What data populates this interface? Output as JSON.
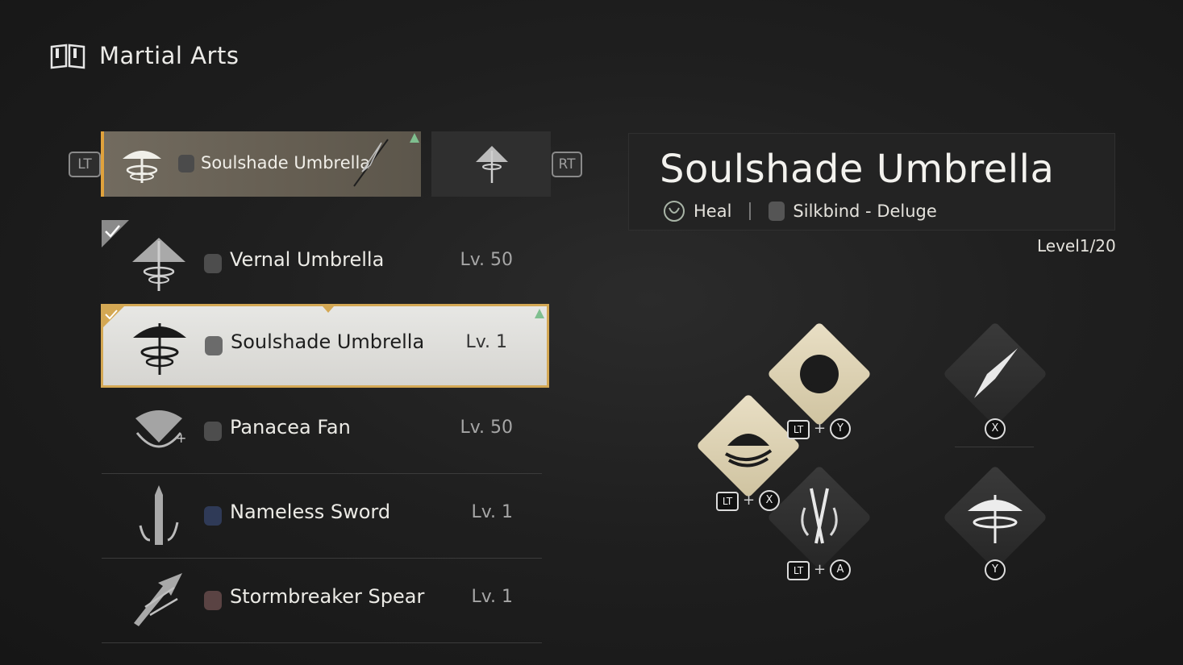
{
  "header": {
    "title": "Martial Arts",
    "icon": "book-icon"
  },
  "loadout": {
    "lt_label": "LT",
    "rt_label": "RT",
    "active_slot_name": "Soulshade Umbrella"
  },
  "weapons": [
    {
      "name": "Vernal Umbrella",
      "level": "Lv. 50",
      "equipped": true
    },
    {
      "name": "Soulshade Umbrella",
      "level": "Lv. 1",
      "equipped": true,
      "selected": true
    },
    {
      "name": "Panacea Fan",
      "level": "Lv. 50"
    },
    {
      "name": "Nameless Sword",
      "level": "Lv. 1"
    },
    {
      "name": "Stormbreaker Spear",
      "level": "Lv. 1"
    }
  ],
  "detail": {
    "title": "Soulshade Umbrella",
    "tag1": "Heal",
    "tag2": "Silkbind - Deluge",
    "level": "Level1/20"
  },
  "skills": {
    "combo1_a": "LT",
    "combo1_b": "Y",
    "combo2_a": "LT",
    "combo2_b": "X",
    "combo3_a": "LT",
    "combo3_b": "A",
    "single1": "X",
    "single2": "Y"
  },
  "colors": {
    "accent": "#e0a23c",
    "selected_border": "#d4a854",
    "up_arrow": "#7fbf8f"
  }
}
